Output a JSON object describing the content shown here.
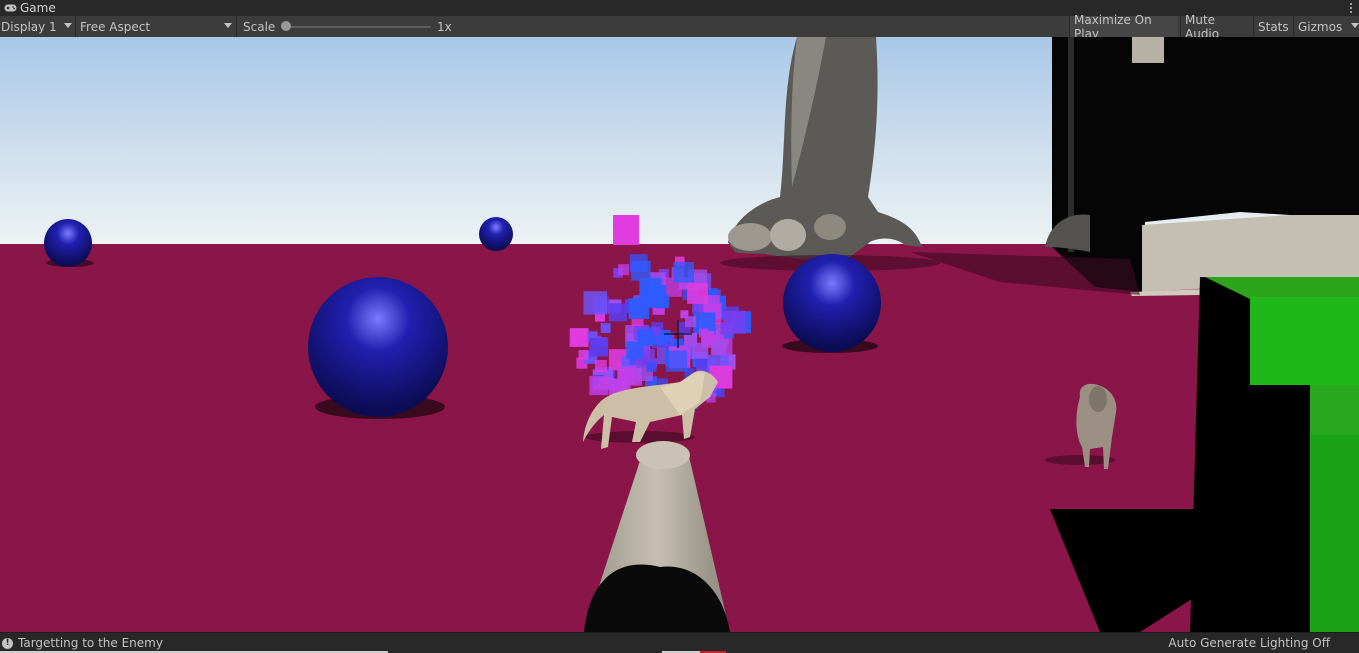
{
  "window": {
    "tab_title": "Game",
    "tab_icon": "gamepad-icon",
    "menu_icon": "kebab-menu-icon"
  },
  "toolbar": {
    "display_label": "Display 1",
    "aspect_label": "Free Aspect",
    "scale_label": "Scale",
    "scale_value": "1x",
    "scale_level": 0,
    "maximize_label": "Maximize On Play",
    "mute_label": "Mute Audio",
    "stats_label": "Stats",
    "gizmos_label": "Gizmos"
  },
  "status": {
    "message": "Targetting to the Enemy",
    "lighting": "Auto Generate Lighting Off",
    "info_icon": "info-icon"
  },
  "scene": {
    "sky_top": "#a9c8e8",
    "sky_bottom": "#eef3f3",
    "ground": "#8a1548",
    "sphere_color": "#1a1a9c",
    "cube_color": "#2ea31c",
    "wall_color": "#000000"
  }
}
